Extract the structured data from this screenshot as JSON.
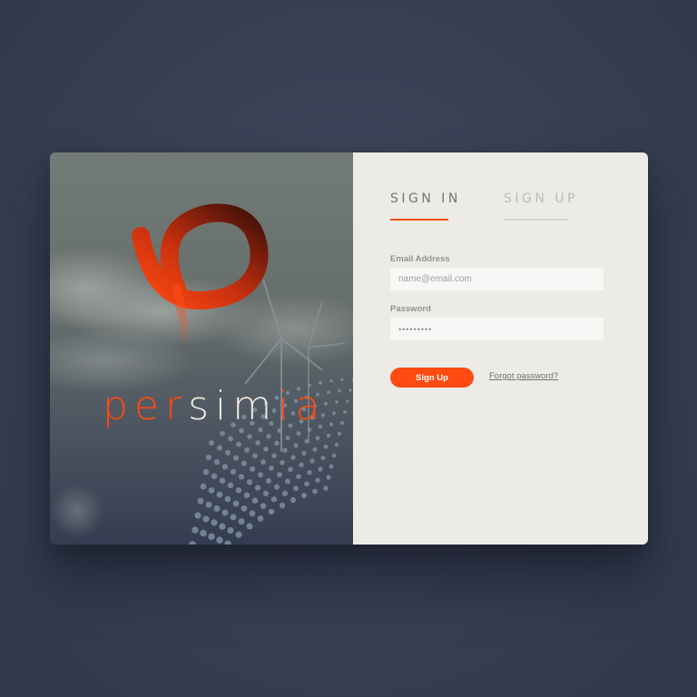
{
  "brand": {
    "word_part1": "per",
    "word_part2": "sim",
    "word_part3": "ia",
    "accent_color": "#ff4a12",
    "logo_icon": "p-swirl-logo-icon"
  },
  "tabs": [
    {
      "label": "SIGN IN",
      "active": true
    },
    {
      "label": "SIGN UP",
      "active": false
    }
  ],
  "form": {
    "email_label": "Email Address",
    "email_placeholder": "name@email.com",
    "password_label": "Password",
    "password_value": "•••••••••",
    "submit_label": "Sign Up",
    "forgot_label": "Forgot password?"
  }
}
